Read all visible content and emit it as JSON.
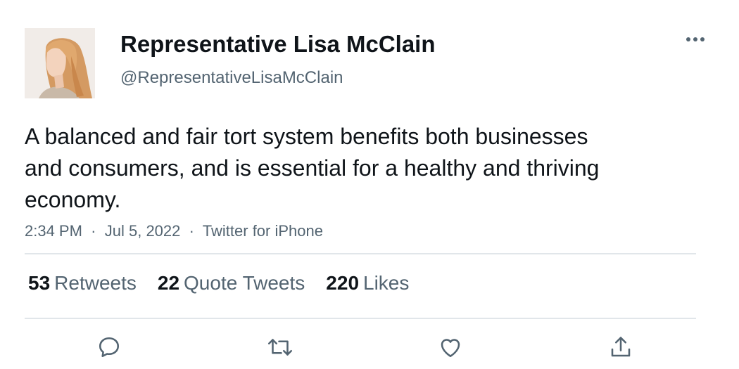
{
  "author": {
    "display_name": "Representative Lisa McClain",
    "handle": "@RepresentativeLisaMcClain",
    "avatar_icon": "profile-photo"
  },
  "tweet": {
    "text": "A balanced and fair tort system benefits both businesses and consumers, and is essential for a healthy and thriving economy.",
    "time": "2:34 PM",
    "date": "Jul 5, 2022",
    "source": "Twitter for iPhone",
    "separator": "·"
  },
  "stats": {
    "retweets_count": "53",
    "retweets_label": "Retweets",
    "quotes_count": "22",
    "quotes_label": "Quote Tweets",
    "likes_count": "220",
    "likes_label": "Likes"
  },
  "actions": {
    "reply_icon": "reply-icon",
    "retweet_icon": "retweet-icon",
    "like_icon": "heart-icon",
    "share_icon": "share-icon",
    "more_icon": "more-options-icon"
  },
  "colors": {
    "text_primary": "#0f1419",
    "text_secondary": "#536471",
    "divider": "#e1e6ea"
  }
}
